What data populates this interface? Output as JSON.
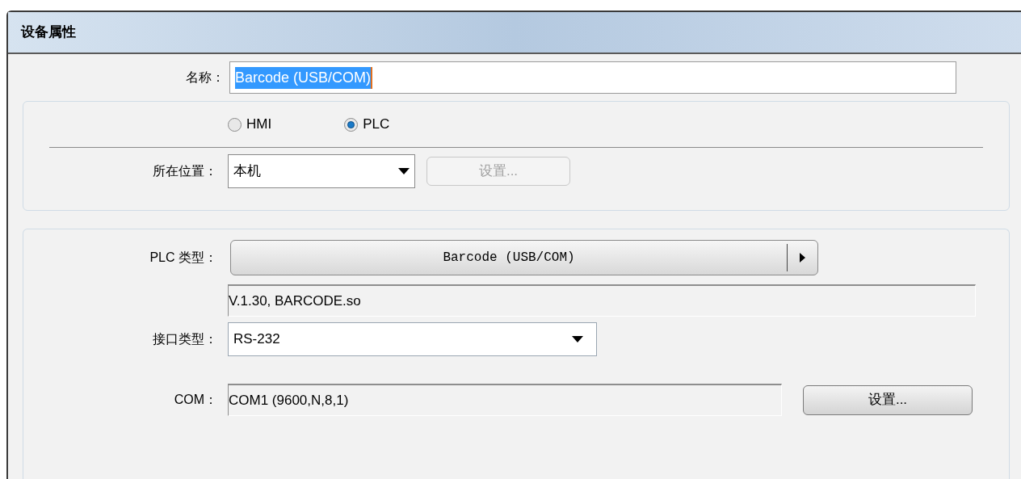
{
  "window": {
    "title": "设备属性"
  },
  "name": {
    "label": "名称：",
    "value": "Barcode (USB/COM)",
    "text_selected": true
  },
  "device_side": {
    "options": [
      {
        "label": "HMI",
        "selected": false
      },
      {
        "label": "PLC",
        "selected": true
      }
    ]
  },
  "location": {
    "label": "所在位置：",
    "value": "本机",
    "button": {
      "label": "设置...",
      "disabled": true
    }
  },
  "plc_type": {
    "label": "PLC 类型：",
    "value": "Barcode (USB/COM)"
  },
  "driver_info": "V.1.30, BARCODE.so",
  "interface": {
    "label": "接口类型：",
    "value": "RS-232"
  },
  "com": {
    "label": "COM：",
    "value": "COM1 (9600,N,8,1)",
    "button": {
      "label": "设置...",
      "disabled": false
    }
  }
}
